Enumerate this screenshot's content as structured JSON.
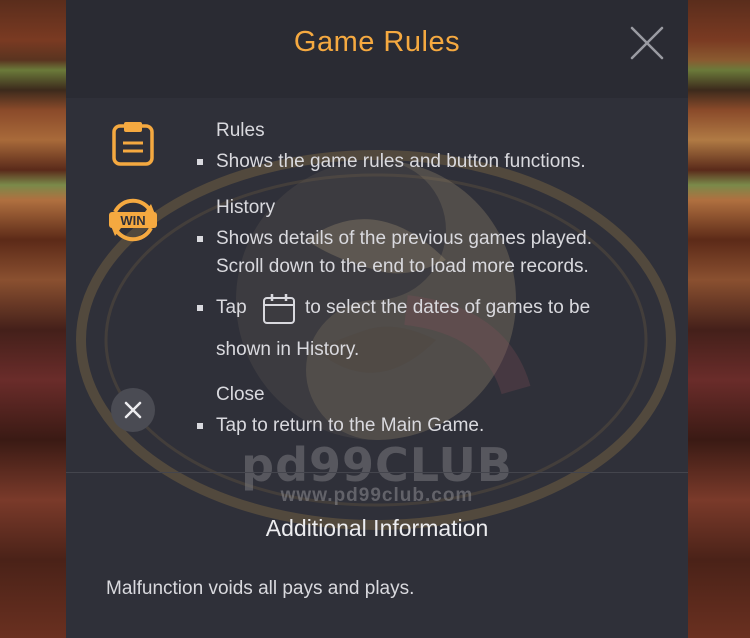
{
  "modal": {
    "title": "Game Rules",
    "watermark_text": "pd99CLUB",
    "watermark_url": "www.pd99club.com"
  },
  "sections": {
    "rules": {
      "title": "Rules",
      "icon": "document-icon",
      "bullet_1": "Shows the game rules and button functions."
    },
    "history": {
      "title": "History",
      "icon": "win-badge-icon",
      "icon_text": "WIN",
      "bullet_1_line_1": "Shows details of the previous games played.",
      "bullet_1_line_2": "Scroll down to the end to load more records.",
      "bullet_2_pre": "Tap",
      "bullet_2_post": "to select the dates of games to be",
      "bullet_2_line_2": "shown in History."
    },
    "close": {
      "title": "Close",
      "icon": "close-circle-icon",
      "bullet_1": "Tap to return to the Main Game."
    }
  },
  "additional": {
    "title": "Additional Information",
    "text": "Malfunction voids all pays and plays."
  },
  "colors": {
    "accent": "#f5a940",
    "modal_bg": "#2f3039",
    "text": "#d9d9de"
  }
}
